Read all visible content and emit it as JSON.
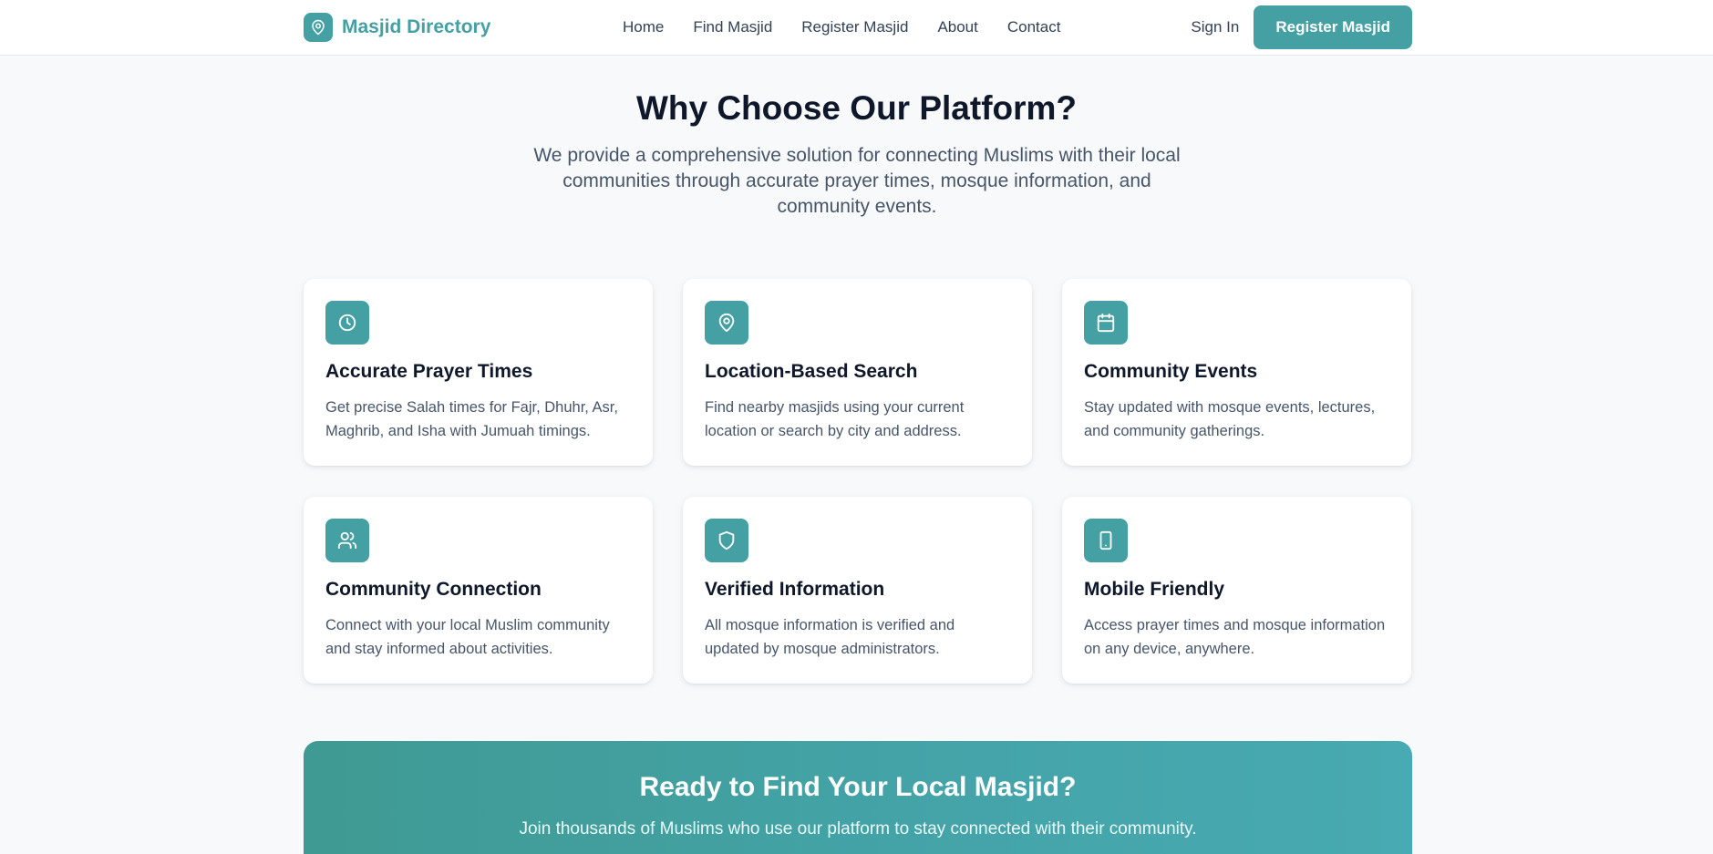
{
  "brand": {
    "name": "Masjid Directory",
    "icon": "map-pin-icon",
    "color": "#45a0a4"
  },
  "nav": {
    "links": [
      "Home",
      "Find Masjid",
      "Register Masjid",
      "About",
      "Contact"
    ],
    "sign_in": "Sign In",
    "cta": "Register Masjid"
  },
  "features": {
    "title": "Why Choose Our Platform?",
    "subtitle": "We provide a comprehensive solution for connecting Muslims with their local communities through accurate prayer times, mosque information, and community events.",
    "cards": [
      {
        "icon": "clock-icon",
        "title": "Accurate Prayer Times",
        "desc": "Get precise Salah times for Fajr, Dhuhr, Asr, Maghrib, and Isha with Jumuah timings."
      },
      {
        "icon": "map-pin-icon",
        "title": "Location-Based Search",
        "desc": "Find nearby masjids using your current location or search by city and address."
      },
      {
        "icon": "calendar-icon",
        "title": "Community Events",
        "desc": "Stay updated with mosque events, lectures, and community gatherings."
      },
      {
        "icon": "users-icon",
        "title": "Community Connection",
        "desc": "Connect with your local Muslim community and stay informed about activities."
      },
      {
        "icon": "shield-icon",
        "title": "Verified Information",
        "desc": "All mosque information is verified and updated by mosque administrators."
      },
      {
        "icon": "smartphone-icon",
        "title": "Mobile Friendly",
        "desc": "Access prayer times and mosque information on any device, anywhere."
      }
    ]
  },
  "cta_banner": {
    "title": "Ready to Find Your Local Masjid?",
    "subtitle": "Join thousands of Muslims who use our platform to stay connected with their community."
  }
}
